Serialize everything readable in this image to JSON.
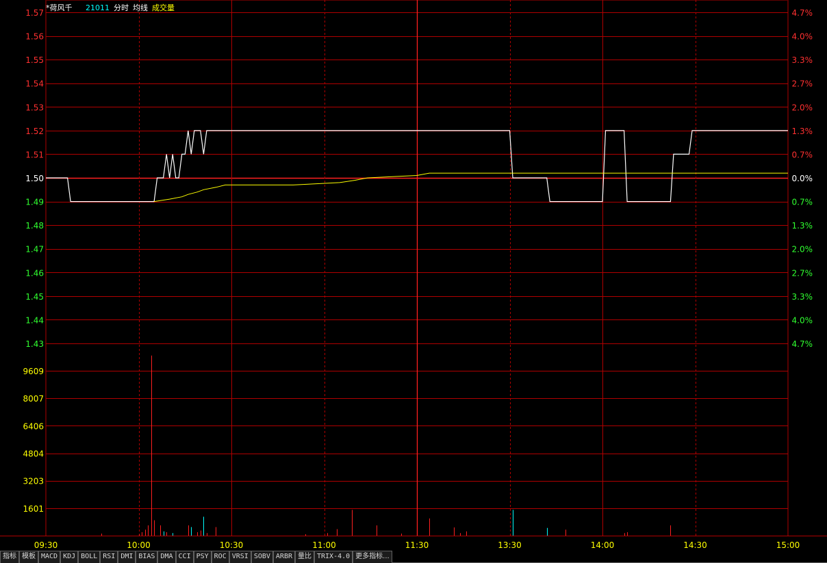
{
  "header": {
    "stock_name": "*荷风千",
    "code": "21011",
    "labels": [
      "分时",
      "均线",
      "成交量"
    ]
  },
  "colors": {
    "grid": "#b00000",
    "price_line": "#ffffff",
    "avg_line": "#ffff00",
    "up": "#ff2020",
    "down": "#00ffff",
    "price_up_text": "#ff3030",
    "price_down_text": "#30ff30",
    "volume_text": "#ffff00"
  },
  "chart_data": {
    "type": "line",
    "price_axis": {
      "base_price": 1.5,
      "ticks_left": [
        "1.57",
        "1.56",
        "1.55",
        "1.54",
        "1.53",
        "1.52",
        "1.51",
        "1.50",
        "1.49",
        "1.48",
        "1.47",
        "1.46",
        "1.45",
        "1.44",
        "1.43"
      ],
      "ticks_right": [
        "4.7%",
        "4.0%",
        "3.3%",
        "2.7%",
        "2.0%",
        "1.3%",
        "0.7%",
        "0.0%",
        "0.7%",
        "1.3%",
        "2.0%",
        "2.7%",
        "3.3%",
        "4.0%",
        "4.7%"
      ],
      "ylim": [
        1.43,
        1.57
      ]
    },
    "volume_axis": {
      "ticks": [
        "9609",
        "8007",
        "6406",
        "4804",
        "3203",
        "1601"
      ],
      "ylim": [
        0,
        11210
      ]
    },
    "time_labels": [
      "09:30",
      "10:00",
      "10:30",
      "11:00",
      "11:30",
      "13:30",
      "14:00",
      "14:30",
      "15:00"
    ],
    "total_minutes": 240,
    "price_series": [
      [
        0,
        1.5
      ],
      [
        7,
        1.5
      ],
      [
        8,
        1.49
      ],
      [
        35,
        1.49
      ],
      [
        36,
        1.5
      ],
      [
        38,
        1.5
      ],
      [
        39,
        1.51
      ],
      [
        40,
        1.5
      ],
      [
        41,
        1.51
      ],
      [
        42,
        1.5
      ],
      [
        43,
        1.5
      ],
      [
        44,
        1.51
      ],
      [
        45,
        1.51
      ],
      [
        46,
        1.52
      ],
      [
        47,
        1.51
      ],
      [
        48,
        1.52
      ],
      [
        50,
        1.52
      ],
      [
        51,
        1.51
      ],
      [
        52,
        1.52
      ],
      [
        150,
        1.52
      ],
      [
        151,
        1.5
      ],
      [
        162,
        1.5
      ],
      [
        163,
        1.49
      ],
      [
        180,
        1.49
      ],
      [
        181,
        1.52
      ],
      [
        187,
        1.52
      ],
      [
        188,
        1.49
      ],
      [
        202,
        1.49
      ],
      [
        203,
        1.51
      ],
      [
        208,
        1.51
      ],
      [
        209,
        1.52
      ],
      [
        240,
        1.52
      ]
    ],
    "avg_series": [
      [
        35,
        1.49
      ],
      [
        40,
        1.491
      ],
      [
        44,
        1.492
      ],
      [
        46,
        1.493
      ],
      [
        49,
        1.494
      ],
      [
        51,
        1.495
      ],
      [
        55,
        1.496
      ],
      [
        58,
        1.497
      ],
      [
        80,
        1.497
      ],
      [
        95,
        1.498
      ],
      [
        100,
        1.499
      ],
      [
        104,
        1.5
      ],
      [
        120,
        1.501
      ],
      [
        124,
        1.502
      ],
      [
        135,
        1.502
      ],
      [
        160,
        1.502
      ],
      [
        180,
        1.502
      ],
      [
        200,
        1.502
      ],
      [
        240,
        1.502
      ]
    ],
    "volume_bars": [
      {
        "t": 18,
        "v": 120,
        "dir": "up"
      },
      {
        "t": 30,
        "v": 80,
        "dir": "up"
      },
      {
        "t": 31,
        "v": 200,
        "dir": "up"
      },
      {
        "t": 32,
        "v": 350,
        "dir": "up"
      },
      {
        "t": 33,
        "v": 600,
        "dir": "up"
      },
      {
        "t": 34,
        "v": 10500,
        "dir": "up"
      },
      {
        "t": 35,
        "v": 900,
        "dir": "up"
      },
      {
        "t": 37,
        "v": 600,
        "dir": "up"
      },
      {
        "t": 38,
        "v": 250,
        "dir": "down"
      },
      {
        "t": 39,
        "v": 200,
        "dir": "up"
      },
      {
        "t": 41,
        "v": 150,
        "dir": "down"
      },
      {
        "t": 46,
        "v": 600,
        "dir": "up"
      },
      {
        "t": 47,
        "v": 500,
        "dir": "down"
      },
      {
        "t": 49,
        "v": 200,
        "dir": "up"
      },
      {
        "t": 50,
        "v": 300,
        "dir": "up"
      },
      {
        "t": 51,
        "v": 1100,
        "dir": "down"
      },
      {
        "t": 52,
        "v": 150,
        "dir": "up"
      },
      {
        "t": 55,
        "v": 500,
        "dir": "up"
      },
      {
        "t": 84,
        "v": 80,
        "dir": "up"
      },
      {
        "t": 91,
        "v": 150,
        "dir": "up"
      },
      {
        "t": 94,
        "v": 380,
        "dir": "up"
      },
      {
        "t": 99,
        "v": 1500,
        "dir": "up"
      },
      {
        "t": 107,
        "v": 600,
        "dir": "up"
      },
      {
        "t": 115,
        "v": 120,
        "dir": "up"
      },
      {
        "t": 124,
        "v": 1000,
        "dir": "up"
      },
      {
        "t": 132,
        "v": 480,
        "dir": "up"
      },
      {
        "t": 134,
        "v": 150,
        "dir": "up"
      },
      {
        "t": 136,
        "v": 250,
        "dir": "up"
      },
      {
        "t": 151,
        "v": 1500,
        "dir": "down"
      },
      {
        "t": 162,
        "v": 450,
        "dir": "down"
      },
      {
        "t": 168,
        "v": 350,
        "dir": "up"
      },
      {
        "t": 187,
        "v": 150,
        "dir": "up"
      },
      {
        "t": 188,
        "v": 200,
        "dir": "up"
      },
      {
        "t": 202,
        "v": 600,
        "dir": "up"
      }
    ]
  },
  "toolbar": {
    "tabs": [
      "指标",
      "模板",
      "MACD",
      "KDJ",
      "BOLL",
      "RSI",
      "DMI",
      "BIAS",
      "DMA",
      "CCI",
      "PSY",
      "ROC",
      "VRSI",
      "SOBV",
      "ARBR",
      "量比",
      "TRIX-4.0",
      "更多指标..."
    ]
  }
}
